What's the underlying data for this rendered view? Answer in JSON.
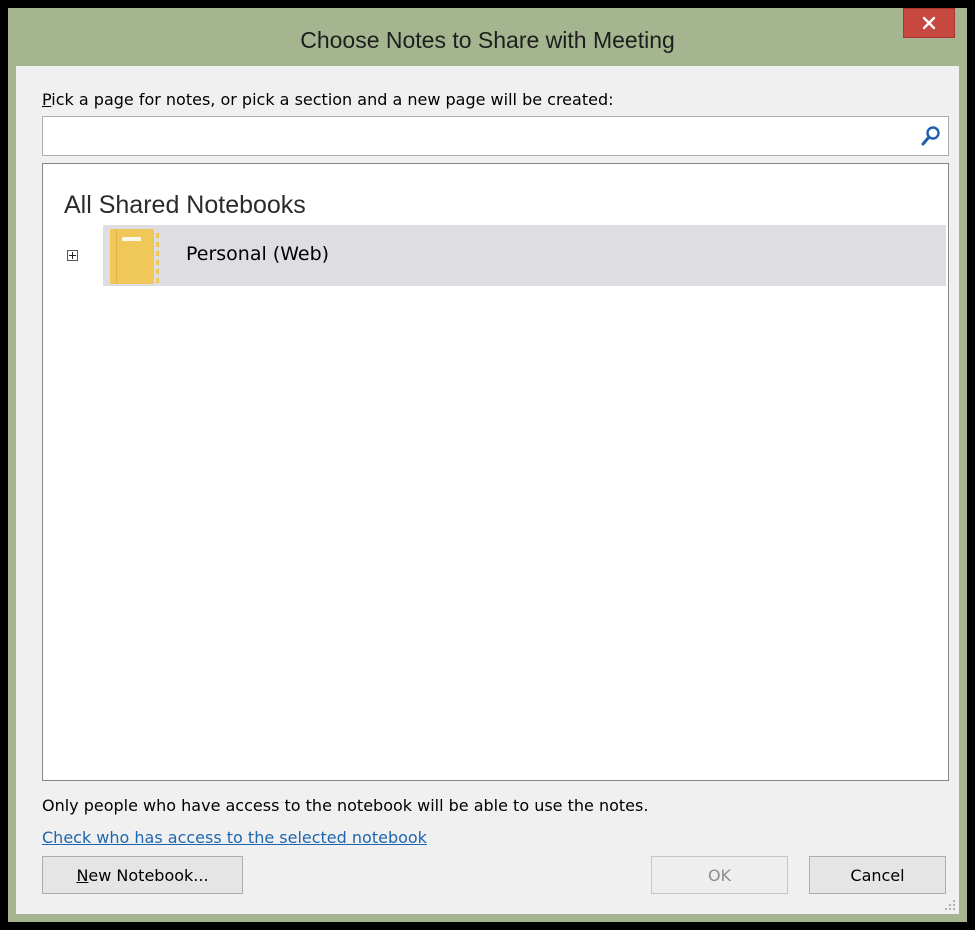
{
  "window": {
    "title": "Choose Notes to Share with Meeting",
    "close_icon": "close-icon"
  },
  "picker": {
    "label_underlined": "P",
    "label_rest": "ick a page for notes, or pick a section and a new page will be created:",
    "search_value": "",
    "search_icon": "search-icon"
  },
  "tree": {
    "header": "All Shared Notebooks",
    "items": [
      {
        "label": "Personal (Web)",
        "icon": "notebook-icon",
        "selected": true,
        "expanded": false
      }
    ]
  },
  "footer": {
    "access_note": "Only people who have access to the notebook will be able to use the notes.",
    "access_link": "Check who has access to the selected notebook",
    "new_notebook_underlined": "N",
    "new_notebook_rest": "ew Notebook...",
    "ok_label": "OK",
    "ok_enabled": false,
    "cancel_label": "Cancel"
  },
  "colors": {
    "frame": "#a5b58f",
    "close_button": "#c7483f",
    "selection": "#dddde2",
    "notebook": "#f0c85a",
    "link": "#1e66b0"
  }
}
